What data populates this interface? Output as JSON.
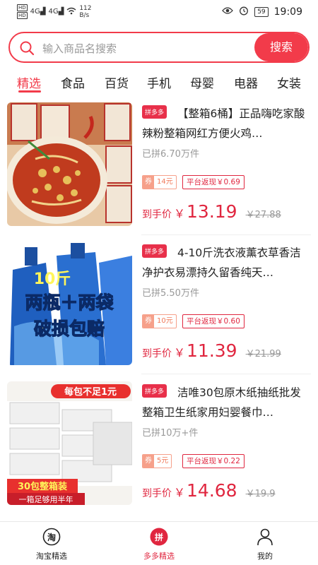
{
  "status_bar": {
    "hd1": "HD",
    "hd2": "HD",
    "signal1": "4G",
    "signal2": "4G",
    "speed": "112",
    "speed_unit": "B/s",
    "battery": "59",
    "time": "19:09"
  },
  "search": {
    "placeholder": "输入商品名搜索",
    "button_label": "搜索"
  },
  "tabs": [
    {
      "label": "精选",
      "active": true
    },
    {
      "label": "食品"
    },
    {
      "label": "百货"
    },
    {
      "label": "手机"
    },
    {
      "label": "母婴"
    },
    {
      "label": "电器"
    },
    {
      "label": "女装"
    }
  ],
  "products": [
    {
      "badge": "拼多多",
      "title": "【整箱6桶】正品嗨吃家酸辣粉整箱网红方便火鸡…",
      "sold": "已拼6.70万件",
      "coupon_tag": "券",
      "coupon_value": "14元",
      "rebate": "平台返现￥0.69",
      "price_label": "到手价",
      "price_yen": "￥",
      "price": "13.19",
      "original_price": "￥27.88",
      "image_theme": "hot-sour-noodles"
    },
    {
      "badge": "拼多多",
      "title": "4-10斤洗衣液薰衣草香洁净护衣易漂持久留香纯天…",
      "sold": "已拼5.50万件",
      "coupon_tag": "券",
      "coupon_value": "10元",
      "rebate": "平台返现￥0.60",
      "price_label": "到手价",
      "price_yen": "￥",
      "price": "11.39",
      "original_price": "￥21.99",
      "image_text": [
        "10斤",
        "两瓶＋两袋",
        "破损包赔"
      ],
      "image_theme": "laundry-detergent"
    },
    {
      "badge": "拼多多",
      "title": "洁唯30包原木纸抽纸批发整箱卫生纸家用妇婴餐巾…",
      "sold": "已拼10万+件",
      "coupon_tag": "券",
      "coupon_value": "5元",
      "rebate": "平台返现￥0.22",
      "price_label": "到手价",
      "price_yen": "￥",
      "price": "14.68",
      "original_price": "￥19.9",
      "image_text": [
        "每包不足1元",
        "30包整箱装",
        "一箱足够用半年"
      ],
      "image_theme": "tissue-paper"
    }
  ],
  "bottom_nav": [
    {
      "label": "淘宝精选",
      "icon_text": "淘"
    },
    {
      "label": "多多精选",
      "icon_text": "拼",
      "active": true
    },
    {
      "label": "我的"
    }
  ],
  "colors": {
    "accent": "#f23b4a",
    "price": "#e0263f"
  }
}
